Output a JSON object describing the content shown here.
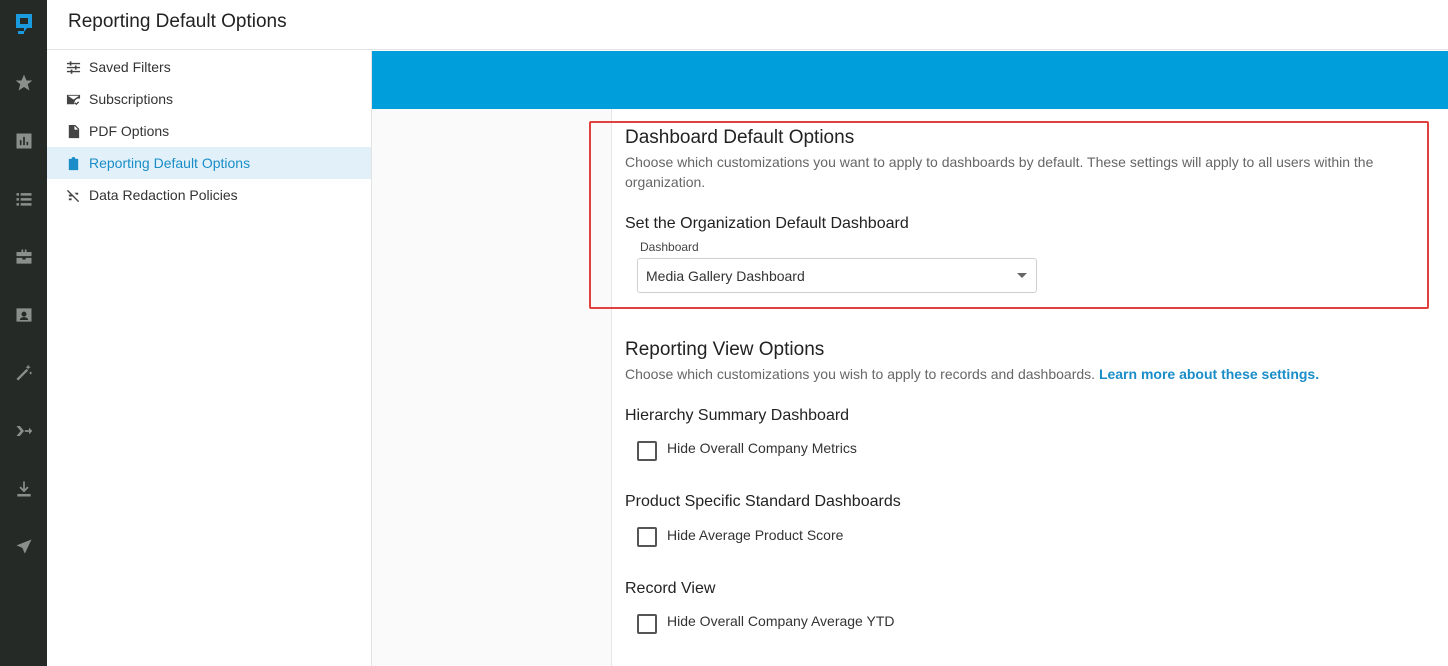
{
  "header": {
    "title": "Reporting Default Options"
  },
  "rail": {
    "logo": "app-logo-icon",
    "icons": [
      "star-icon",
      "chart-icon",
      "list-icon",
      "briefcase-icon",
      "contact-card-icon",
      "magic-wand-icon",
      "flow-arrow-icon",
      "download-icon",
      "send-icon"
    ]
  },
  "sidebar": {
    "items": [
      {
        "label": "Saved Filters",
        "icon": "sliders-icon"
      },
      {
        "label": "Subscriptions",
        "icon": "mail-check-icon"
      },
      {
        "label": "PDF Options",
        "icon": "pdf-file-icon"
      },
      {
        "label": "Reporting Default Options",
        "icon": "clipboard-icon",
        "active": true
      },
      {
        "label": "Data Redaction Policies",
        "icon": "redaction-icon"
      }
    ]
  },
  "dashboard_defaults": {
    "title": "Dashboard Default Options",
    "description": "Choose which customizations you want to apply to dashboards by default. These settings will apply to all users within the organization.",
    "org_default_heading": "Set the Organization Default Dashboard",
    "select_label": "Dashboard",
    "select_value": "Media Gallery Dashboard"
  },
  "reporting_view": {
    "title": "Reporting View Options",
    "description": "Choose which customizations you wish to apply to records and dashboards.",
    "learn_more": "Learn more about these settings.",
    "groups": [
      {
        "heading": "Hierarchy Summary Dashboard",
        "option": "Hide Overall Company Metrics",
        "checked": false
      },
      {
        "heading": "Product Specific Standard Dashboards",
        "option": "Hide Average Product Score",
        "checked": false
      },
      {
        "heading": "Record View",
        "option": "Hide Overall Company Average YTD",
        "checked": false
      }
    ]
  },
  "colors": {
    "accent": "#009fdb",
    "highlight": "#e0403f",
    "rail": "#252a27",
    "active_bg": "#e2f1f9"
  }
}
